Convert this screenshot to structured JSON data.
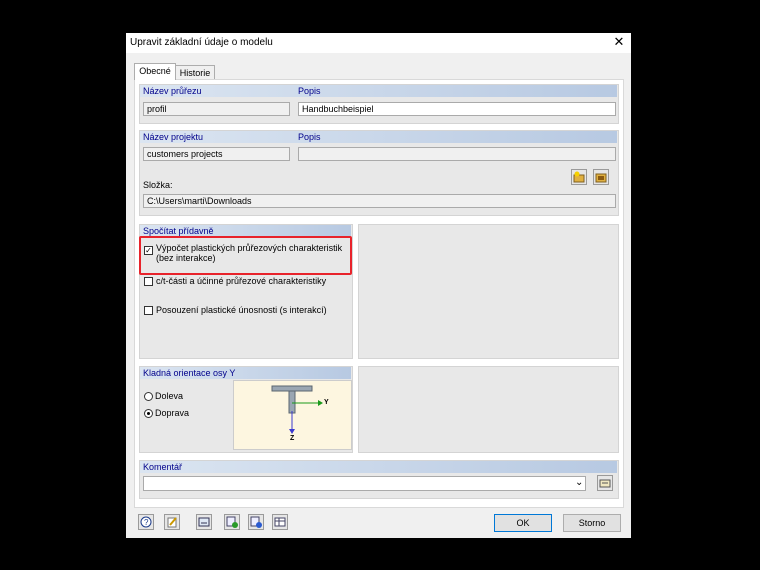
{
  "window": {
    "title": "Upravit základní údaje o modelu",
    "close": "✕"
  },
  "tabs": [
    {
      "label": "Obecné"
    },
    {
      "label": "Historie"
    }
  ],
  "section_profile": {
    "name_label": "Název průřezu",
    "name_value": "profil",
    "desc_label": "Popis",
    "desc_value": "Handbuchbeispiel"
  },
  "section_project": {
    "name_label": "Název projektu",
    "name_value": "customers projects",
    "desc_label": "Popis",
    "desc_value": "",
    "folder_label": "Složka:",
    "folder_value": "C:\\Users\\marti\\Downloads"
  },
  "calc": {
    "label": "Spočítat přídavně",
    "options": [
      {
        "label": "Výpočet plastických průřezových charakteristik (bez interakce)",
        "checked": true
      },
      {
        "label": "c/t-části a účinné průřezové charakteristiky",
        "checked": false
      },
      {
        "label": "Posouzení plastické únosnosti (s interakcí)",
        "checked": false
      }
    ]
  },
  "orientation": {
    "label": "Kladná orientace osy Y",
    "left": "Doleva",
    "right": "Doprava",
    "selected": "Doprava",
    "axis_y": "Y",
    "axis_z": "Z"
  },
  "comment": {
    "label": "Komentář",
    "value": ""
  },
  "footer": {
    "ok": "OK",
    "cancel": "Storno"
  },
  "colors": {
    "highlight": "#e8232b",
    "header_text": "#00008b",
    "ok_border": "#0078d7"
  }
}
